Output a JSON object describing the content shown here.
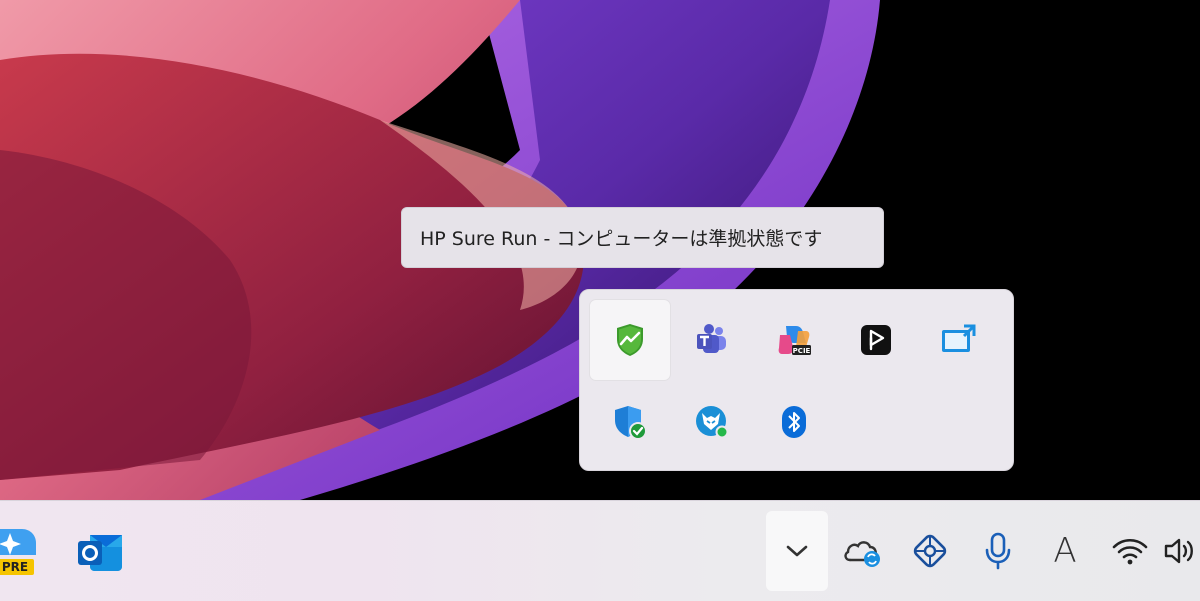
{
  "tooltip": {
    "text": "HP Sure Run - コンピューターは準拠状態です"
  },
  "tray_overflow": {
    "items": [
      {
        "icon": "hp-sure-run-shield-icon"
      },
      {
        "icon": "teams-icon"
      },
      {
        "icon": "copilot-preview-icon"
      },
      {
        "icon": "media-player-icon"
      },
      {
        "icon": "screen-share-icon"
      },
      {
        "icon": "security-shield-check-icon"
      },
      {
        "icon": "vpn-fox-icon"
      },
      {
        "icon": "bluetooth-icon"
      }
    ]
  },
  "taskbar": {
    "pinned": [
      {
        "icon": "app-preview-icon",
        "badge": "PRE"
      },
      {
        "icon": "outlook-icon"
      }
    ],
    "tray": {
      "overflow_icon": "chevron-down-icon",
      "items": [
        {
          "icon": "onedrive-sync-icon"
        },
        {
          "icon": "network-hub-icon"
        },
        {
          "icon": "microphone-icon"
        },
        {
          "icon": "ime-icon",
          "label": "A"
        },
        {
          "icon": "wifi-icon"
        },
        {
          "icon": "volume-icon"
        }
      ]
    }
  },
  "colors": {
    "flyout_bg": "#ebe8ee",
    "taskbar_bg": "#ecebee",
    "accent_blue": "#0a6cd8",
    "hp_green": "#3c9a2c"
  }
}
